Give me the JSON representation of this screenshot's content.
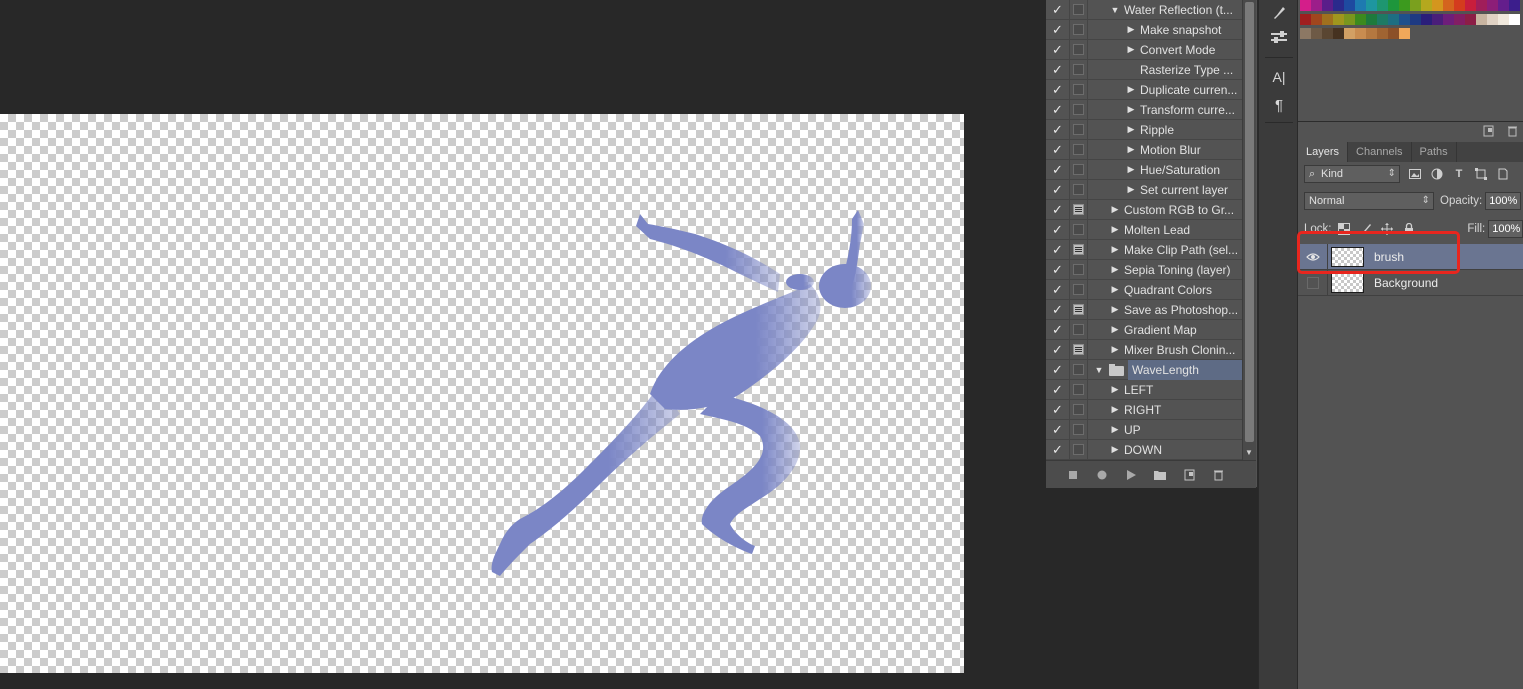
{
  "actions_panel": {
    "rows": [
      {
        "label": "Water Reflection (t...",
        "checked": "✓",
        "dialog": false,
        "expand": "▼",
        "indent": 0
      },
      {
        "label": "Make snapshot",
        "checked": "✓",
        "dialog": false,
        "expand": "▶",
        "indent": 1
      },
      {
        "label": "Convert Mode",
        "checked": "✓",
        "dialog": false,
        "expand": "▶",
        "indent": 1
      },
      {
        "label": "Rasterize Type ...",
        "checked": "✓",
        "dialog": false,
        "expand": "",
        "indent": 1
      },
      {
        "label": "Duplicate curren...",
        "checked": "✓",
        "dialog": false,
        "expand": "▶",
        "indent": 1
      },
      {
        "label": "Transform curre...",
        "checked": "✓",
        "dialog": false,
        "expand": "▶",
        "indent": 1
      },
      {
        "label": "Ripple",
        "checked": "✓",
        "dialog": false,
        "expand": "▶",
        "indent": 1
      },
      {
        "label": "Motion Blur",
        "checked": "✓",
        "dialog": false,
        "expand": "▶",
        "indent": 1
      },
      {
        "label": "Hue/Saturation",
        "checked": "✓",
        "dialog": false,
        "expand": "▶",
        "indent": 1
      },
      {
        "label": "Set current layer",
        "checked": "✓",
        "dialog": false,
        "expand": "▶",
        "indent": 1
      },
      {
        "label": "Custom RGB to Gr...",
        "checked": "✓",
        "dialog": true,
        "expand": "▶",
        "indent": 0
      },
      {
        "label": "Molten Lead",
        "checked": "✓",
        "dialog": false,
        "expand": "▶",
        "indent": 0
      },
      {
        "label": "Make Clip Path (sel...",
        "checked": "✓",
        "dialog": true,
        "expand": "▶",
        "indent": 0
      },
      {
        "label": "Sepia Toning (layer)",
        "checked": "✓",
        "dialog": false,
        "expand": "▶",
        "indent": 0
      },
      {
        "label": "Quadrant Colors",
        "checked": "✓",
        "dialog": false,
        "expand": "▶",
        "indent": 0
      },
      {
        "label": "Save as Photoshop...",
        "checked": "✓",
        "dialog": true,
        "expand": "▶",
        "indent": 0
      },
      {
        "label": "Gradient Map",
        "checked": "✓",
        "dialog": false,
        "expand": "▶",
        "indent": 0
      },
      {
        "label": "Mixer Brush Clonin...",
        "checked": "✓",
        "dialog": true,
        "expand": "▶",
        "indent": 0
      },
      {
        "label": "WaveLength",
        "checked": "✓",
        "dialog": false,
        "expand": "▼",
        "indent": -1,
        "folder": true,
        "selected": true
      },
      {
        "label": "LEFT",
        "checked": "✓",
        "dialog": false,
        "expand": "▶",
        "indent": 0
      },
      {
        "label": "RIGHT",
        "checked": "✓",
        "dialog": false,
        "expand": "▶",
        "indent": 0
      },
      {
        "label": "UP",
        "checked": "✓",
        "dialog": false,
        "expand": "▶",
        "indent": 0
      },
      {
        "label": "DOWN",
        "checked": "✓",
        "dialog": false,
        "expand": "▶",
        "indent": 0
      }
    ],
    "footer_icons": [
      "stop-icon",
      "record-icon",
      "play-icon",
      "new-set-icon",
      "new-action-icon",
      "delete-icon"
    ]
  },
  "tool_strip": {
    "tools": [
      "brush-tool-icon",
      "adjust-sliders-icon",
      "character-icon",
      "paragraph-icon"
    ],
    "character_glyph": "A|",
    "paragraph_glyph": "¶"
  },
  "swatches": {
    "rows": [
      [
        "#d41e8a",
        "#9c1e8a",
        "#5a1e8a",
        "#2a2a8c",
        "#1e4aa0",
        "#1e7ab0",
        "#1e96a0",
        "#1e9670",
        "#1e963c",
        "#3c9a1e",
        "#7aa01e",
        "#b4a81e",
        "#d4961e",
        "#d4641e",
        "#d43c1e",
        "#c81e3c",
        "#a01e5a",
        "#8c1e78",
        "#641e8c",
        "#3c1e8c"
      ],
      [
        "#a01e1e",
        "#a0461e",
        "#a0701e",
        "#a0961e",
        "#7a961e",
        "#3c8a1e",
        "#1e7a3c",
        "#1e7a64",
        "#1e6e82",
        "#1e508c",
        "#1e3a82",
        "#2a1e7a",
        "#4a1e7a",
        "#6e1e7a",
        "#821e64",
        "#8c1e46",
        "#c8b4a0",
        "#e0d2c4",
        "#f0e8dc",
        "#ffffff"
      ],
      [
        "#8c7864",
        "#6e5a46",
        "#5a4632",
        "#463220",
        "#d2a064",
        "#c88c50",
        "#b47840",
        "#a06432",
        "#8c5028",
        "#f0a85a"
      ]
    ],
    "footer_icons": [
      "new-swatch-icon",
      "delete-swatch-icon"
    ]
  },
  "layers_panel": {
    "tabs": [
      {
        "label": "Layers",
        "active": true
      },
      {
        "label": "Channels",
        "active": false
      },
      {
        "label": "Paths",
        "active": false
      }
    ],
    "filter_kind": "Kind",
    "filter_icons": [
      "pixel-filter-icon",
      "adjustment-filter-icon",
      "type-filter-icon",
      "shape-filter-icon",
      "smart-object-filter-icon"
    ],
    "blend_mode": "Normal",
    "opacity_label": "Opacity:",
    "opacity_value": "100%",
    "lock_label": "Lock:",
    "lock_icons": [
      "lock-transparent-icon",
      "lock-image-icon",
      "lock-position-icon",
      "lock-all-icon"
    ],
    "fill_label": "Fill:",
    "fill_value": "100%",
    "layers": [
      {
        "name": "brush",
        "visible": true,
        "selected": true
      },
      {
        "name": "Background",
        "visible": false,
        "selected": false
      }
    ]
  },
  "canvas": {
    "figure_color": "#7b86c6",
    "content": "silhouette of sprinter at starting position"
  },
  "annotation": {
    "highlight_color": "#e8261e",
    "target": "brush layer"
  }
}
